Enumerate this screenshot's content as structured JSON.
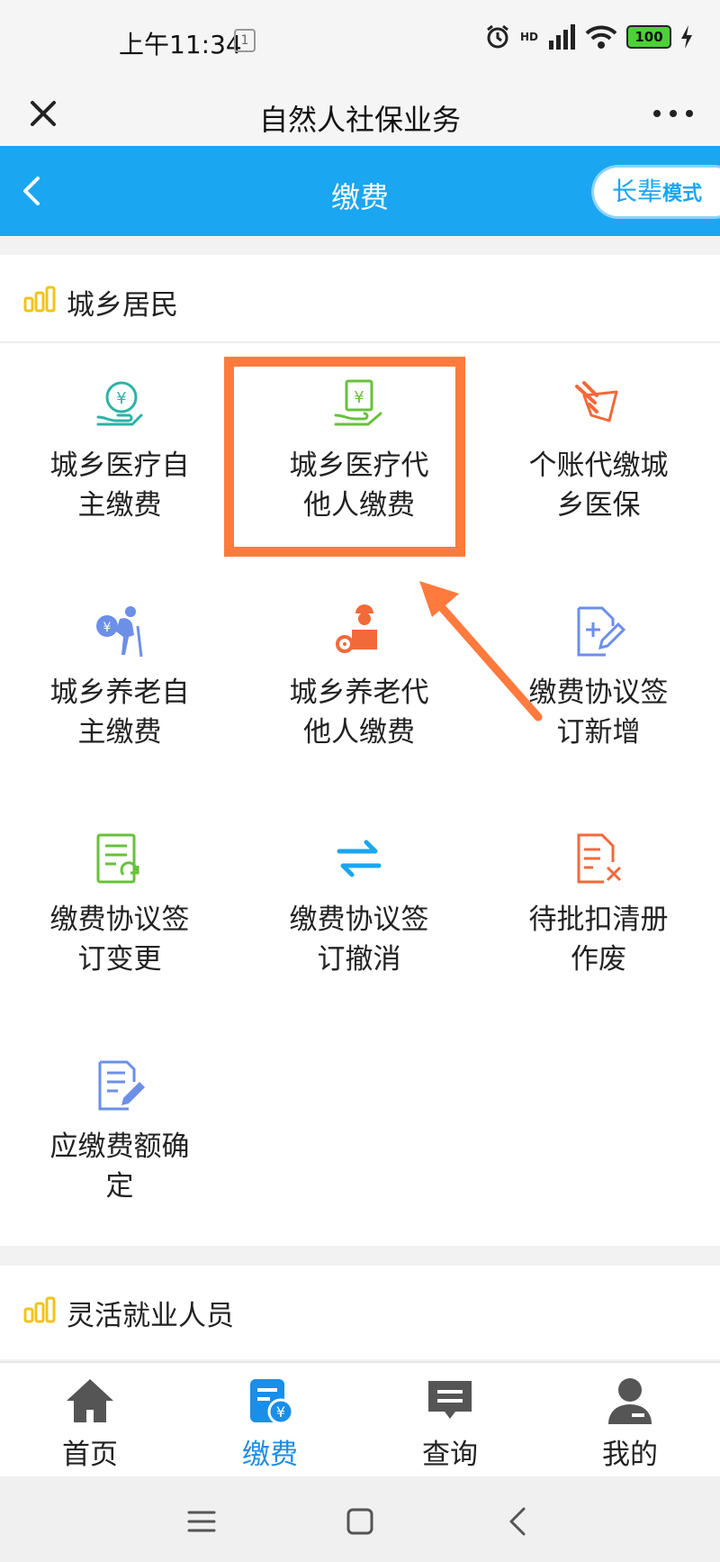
{
  "status_bar": {
    "time": "上午11:34",
    "notification_badge": "1",
    "hd_label": "HD",
    "battery_level": "100"
  },
  "title_bar": {
    "title": "自然人社保业务"
  },
  "nav_bar": {
    "title": "缴费",
    "elder_mode_main": "长辈",
    "elder_mode_sub": "模式"
  },
  "sections": [
    {
      "title": "城乡居民",
      "items": [
        {
          "line1": "城乡医疗自",
          "line2": "主缴费",
          "icon": "yuan-hand-icon",
          "color": "#2bb3a6"
        },
        {
          "line1": "城乡医疗代",
          "line2": "他人缴费",
          "icon": "yuan-document-hand-icon",
          "color": "#67c23a"
        },
        {
          "line1": "个账代缴城",
          "line2": "乡医保",
          "icon": "rocket-card-icon",
          "color": "#f2693a"
        },
        {
          "line1": "城乡养老自",
          "line2": "主缴费",
          "icon": "elderly-yuan-icon",
          "color": "#6c8fe8"
        },
        {
          "line1": "城乡养老代",
          "line2": "他人缴费",
          "icon": "worker-gear-icon",
          "color": "#f2693a"
        },
        {
          "line1": "缴费协议签",
          "line2": "订新增",
          "icon": "document-add-icon",
          "color": "#6c8fe8"
        },
        {
          "line1": "缴费协议签",
          "line2": "订变更",
          "icon": "document-refresh-icon",
          "color": "#67c23a"
        },
        {
          "line1": "缴费协议签",
          "line2": "订撤消",
          "icon": "exchange-arrows-icon",
          "color": "#1aa6f0"
        },
        {
          "line1": "待批扣清册",
          "line2": "作废",
          "icon": "document-cancel-icon",
          "color": "#f2693a"
        },
        {
          "line1": "应缴费额确",
          "line2": "定",
          "icon": "document-edit-icon",
          "color": "#6c8fe8"
        }
      ]
    },
    {
      "title": "灵活就业人员"
    }
  ],
  "tab_bar": {
    "tabs": [
      {
        "label": "首页",
        "icon": "home-icon"
      },
      {
        "label": "缴费",
        "icon": "payment-icon"
      },
      {
        "label": "查询",
        "icon": "message-icon"
      },
      {
        "label": "我的",
        "icon": "user-icon"
      }
    ],
    "active": "缴费"
  },
  "colors": {
    "primary_blue": "#1aa6f0",
    "highlight_orange": "#ff7a3d",
    "section_icon": "#f0c419"
  }
}
